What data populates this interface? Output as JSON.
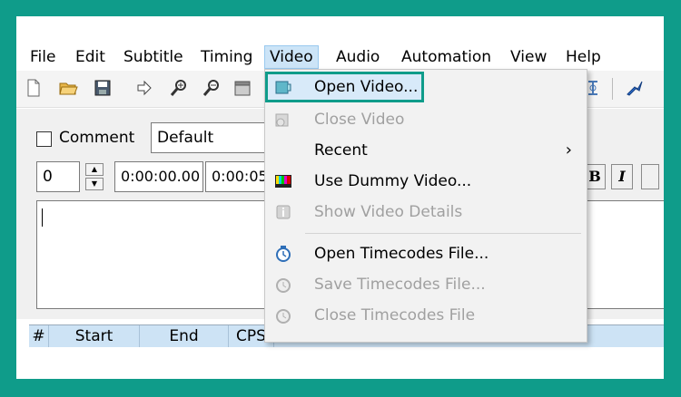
{
  "menubar": {
    "items": [
      "File",
      "Edit",
      "Subtitle",
      "Timing",
      "Video",
      "Audio",
      "Automation",
      "View",
      "Help"
    ]
  },
  "edit": {
    "comment_label": "Comment",
    "style_value": "Default",
    "layer_value": "0",
    "start_time": "0:00:00.00",
    "end_time": "0:00:05",
    "bold_label": "B",
    "italic_label": "I"
  },
  "grid": {
    "columns": [
      "#",
      "Start",
      "End",
      "CPS"
    ]
  },
  "video_menu": {
    "items": [
      {
        "label": "Open Video...",
        "enabled": true,
        "icon": "open-video-icon"
      },
      {
        "label": "Close Video",
        "enabled": false,
        "icon": "close-video-icon"
      },
      {
        "label": "Recent",
        "enabled": true,
        "icon": "",
        "submenu_arrow": "›"
      },
      {
        "label": "Use Dummy Video...",
        "enabled": true,
        "icon": "color-bars-icon"
      },
      {
        "label": "Show Video Details",
        "enabled": false,
        "icon": "info-icon"
      },
      {
        "label": "Open Timecodes File...",
        "enabled": true,
        "icon": "timecodes-icon"
      },
      {
        "label": "Save Timecodes File...",
        "enabled": false,
        "icon": "save-timecodes-icon"
      },
      {
        "label": "Close Timecodes File",
        "enabled": false,
        "icon": "close-timecodes-icon"
      }
    ]
  },
  "colors": {
    "frame": "#0f9c8a",
    "highlight": "#d8eaf9",
    "disabled_text": "#a0a0a0"
  }
}
